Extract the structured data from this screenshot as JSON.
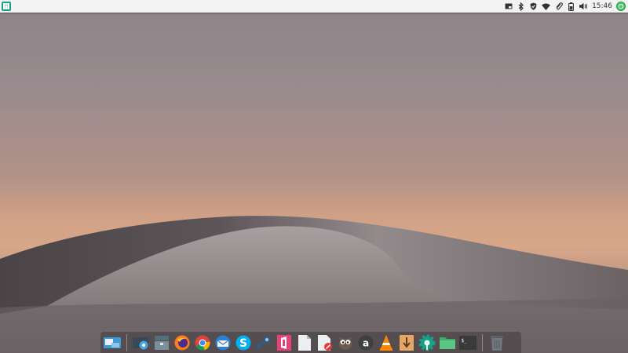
{
  "top_panel": {
    "clock": "15:46"
  },
  "tray_icons": [
    "screen-icon",
    "bluetooth-icon",
    "shield-icon",
    "wifi-icon",
    "clipboard-icon",
    "battery-icon",
    "volume-icon"
  ],
  "dock": {
    "items": [
      "workspace-switcher",
      "screenshot-tool",
      "archive-manager",
      "firefox",
      "chrome",
      "mail-client",
      "skype",
      "steam",
      "office",
      "text-editor",
      "document-viewer",
      "gimp",
      "anydesk",
      "vlc",
      "download-manager",
      "settings",
      "file-manager",
      "terminal",
      "trash"
    ]
  },
  "colors": {
    "panel": "#f3f3f3",
    "accent": "#16a085"
  }
}
